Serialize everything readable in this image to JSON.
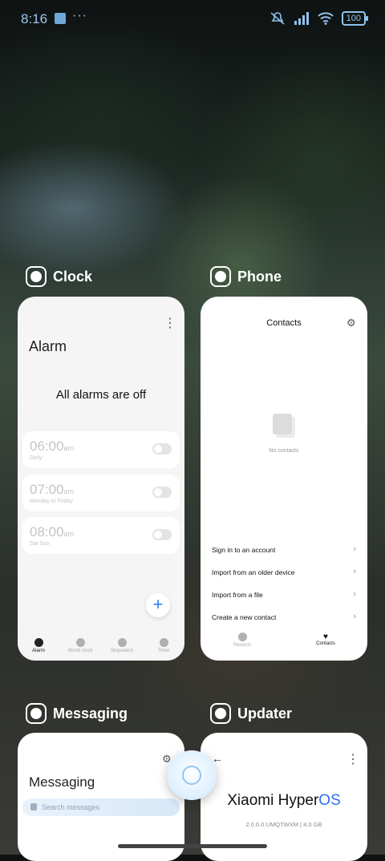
{
  "status_bar": {
    "time": "8:16",
    "more": "···",
    "battery": "100"
  },
  "clock": {
    "app_name": "Clock",
    "more": "⋮",
    "title": "Alarm",
    "empty_message": "All alarms are off",
    "alarms": [
      {
        "time": "06:00",
        "ampm": "am",
        "label": "Daily"
      },
      {
        "time": "07:00",
        "ampm": "am",
        "label": "Monday to Friday"
      },
      {
        "time": "08:00",
        "ampm": "am",
        "label": "Sat Sun"
      }
    ],
    "fab": "+",
    "nav": [
      {
        "label": "Alarm",
        "active": true
      },
      {
        "label": "World clock",
        "active": false
      },
      {
        "label": "Stopwatch",
        "active": false
      },
      {
        "label": "Timer",
        "active": false
      }
    ]
  },
  "phone": {
    "app_name": "Phone",
    "title": "Contacts",
    "settings_icon": "⚙",
    "empty_message": "No contacts",
    "actions": [
      "Sign in to an account",
      "Import from an older device",
      "Import from a file",
      "Create a new contact"
    ],
    "chevron": "›",
    "nav": [
      {
        "label": "Recents",
        "active": false
      },
      {
        "label": "Contacts",
        "active": true
      }
    ],
    "heart": "♥"
  },
  "messaging": {
    "app_name": "Messaging",
    "settings_icon": "⚙",
    "title": "Messaging",
    "search_placeholder": "Search messages"
  },
  "updater": {
    "app_name": "Updater",
    "back": "←",
    "more": "⋮",
    "brand": "Xiaomi Hyper",
    "brand_accent": "OS",
    "version": "2.0.6.0.UMQTWXM | 4.0 GB"
  }
}
